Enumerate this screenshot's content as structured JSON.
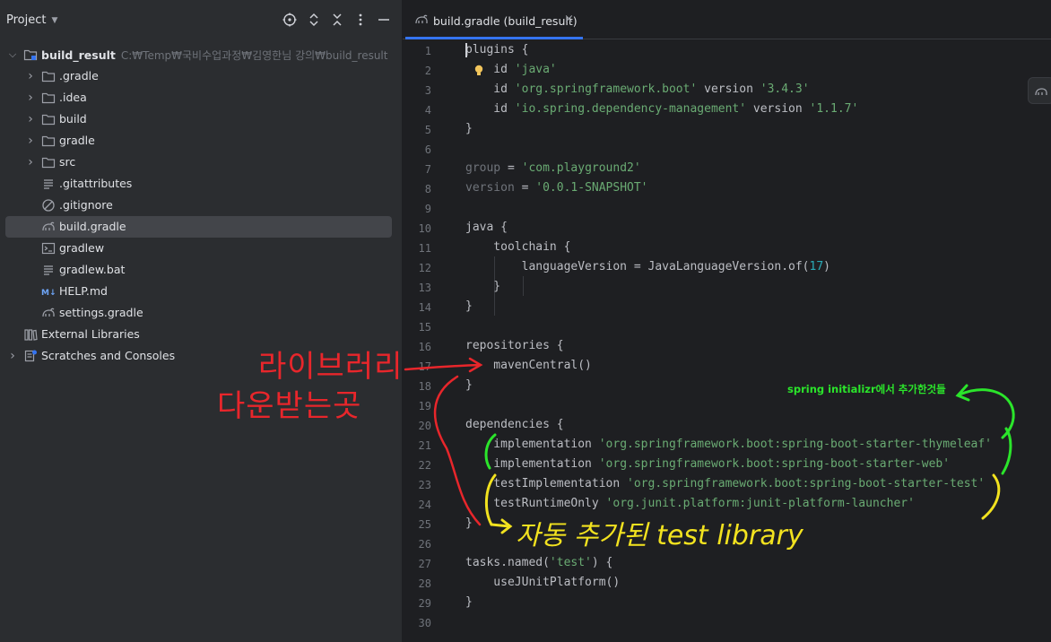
{
  "project_panel": {
    "title": "Project",
    "tree": [
      {
        "label": "build_result",
        "path": "C:₩Temp₩국비수업과정₩김영한님 강의₩build_result",
        "icon": "module-folder-icon",
        "expand": "expanded",
        "depth": 0
      },
      {
        "label": ".gradle",
        "icon": "folder-icon",
        "expand": "collapsed",
        "depth": 1
      },
      {
        "label": ".idea",
        "icon": "folder-icon",
        "expand": "collapsed",
        "depth": 1
      },
      {
        "label": "build",
        "icon": "folder-icon",
        "expand": "collapsed",
        "depth": 1
      },
      {
        "label": "gradle",
        "icon": "folder-icon",
        "expand": "collapsed",
        "depth": 1
      },
      {
        "label": "src",
        "icon": "folder-icon",
        "expand": "collapsed",
        "depth": 1
      },
      {
        "label": ".gitattributes",
        "icon": "text-file-icon",
        "expand": "none",
        "depth": 1
      },
      {
        "label": ".gitignore",
        "icon": "ignore-file-icon",
        "expand": "none",
        "depth": 1
      },
      {
        "label": "build.gradle",
        "icon": "gradle-elephant-icon",
        "expand": "none",
        "depth": 1,
        "selected": true
      },
      {
        "label": "gradlew",
        "icon": "terminal-file-icon",
        "expand": "none",
        "depth": 1
      },
      {
        "label": "gradlew.bat",
        "icon": "text-file-icon",
        "expand": "none",
        "depth": 1
      },
      {
        "label": "HELP.md",
        "icon": "markdown-file-icon",
        "expand": "none",
        "depth": 1
      },
      {
        "label": "settings.gradle",
        "icon": "gradle-elephant-icon",
        "expand": "none",
        "depth": 1
      },
      {
        "label": "External Libraries",
        "icon": "library-icon",
        "expand": "none",
        "depth": 0
      },
      {
        "label": "Scratches and Consoles",
        "icon": "scratches-icon",
        "expand": "collapsed",
        "depth": 0
      }
    ]
  },
  "editor": {
    "tab_label": "build.gradle (build_result)",
    "tab_close": "×",
    "line_numbers": [
      "1",
      "2",
      "3",
      "4",
      "5",
      "6",
      "7",
      "8",
      "9",
      "10",
      "11",
      "12",
      "13",
      "14",
      "15",
      "16",
      "17",
      "18",
      "19",
      "20",
      "21",
      "22",
      "23",
      "24",
      "25",
      "26",
      "27",
      "28",
      "29",
      "30"
    ],
    "code": [
      [
        {
          "t": "plugins {"
        }
      ],
      [
        {
          "t": "    id "
        },
        {
          "t": "'java'",
          "c": "str"
        }
      ],
      [
        {
          "t": "    id "
        },
        {
          "t": "'org.springframework.boot'",
          "c": "str"
        },
        {
          "t": " version "
        },
        {
          "t": "'3.4.3'",
          "c": "str"
        }
      ],
      [
        {
          "t": "    id "
        },
        {
          "t": "'io.spring.dependency-management'",
          "c": "str"
        },
        {
          "t": " version "
        },
        {
          "t": "'1.1.7'",
          "c": "str"
        }
      ],
      [
        {
          "t": "}"
        }
      ],
      [],
      [
        {
          "t": "group",
          "c": "dim"
        },
        {
          "t": " = "
        },
        {
          "t": "'com.playground2'",
          "c": "str"
        }
      ],
      [
        {
          "t": "version",
          "c": "dim"
        },
        {
          "t": " = "
        },
        {
          "t": "'0.0.1-SNAPSHOT'",
          "c": "str"
        }
      ],
      [],
      [
        {
          "t": "java {"
        }
      ],
      [
        {
          "t": "    toolchain {"
        }
      ],
      [
        {
          "t": "        languageVersion = JavaLanguageVersion.of("
        },
        {
          "t": "17",
          "c": "num"
        },
        {
          "t": ")"
        }
      ],
      [
        {
          "t": "    }"
        }
      ],
      [
        {
          "t": "}"
        }
      ],
      [],
      [
        {
          "t": "repositories {"
        }
      ],
      [
        {
          "t": "    mavenCentral()"
        }
      ],
      [
        {
          "t": "}"
        }
      ],
      [],
      [
        {
          "t": "dependencies {"
        }
      ],
      [
        {
          "t": "    implementation "
        },
        {
          "t": "'org.springframework.boot:spring-boot-starter-thymeleaf'",
          "c": "str"
        }
      ],
      [
        {
          "t": "    implementation "
        },
        {
          "t": "'org.springframework.boot:spring-boot-starter-web'",
          "c": "str"
        }
      ],
      [
        {
          "t": "    testImplementation "
        },
        {
          "t": "'org.springframework.boot:spring-boot-starter-test'",
          "c": "str"
        }
      ],
      [
        {
          "t": "    testRuntimeOnly "
        },
        {
          "t": "'org.junit.platform:junit-platform-launcher'",
          "c": "str"
        }
      ],
      [
        {
          "t": "}"
        }
      ],
      [],
      [
        {
          "t": "tasks.named("
        },
        {
          "t": "'test'",
          "c": "str"
        },
        {
          "t": ") {"
        }
      ],
      [
        {
          "t": "    useJUnitPlatform()"
        }
      ],
      [
        {
          "t": "}"
        }
      ],
      []
    ]
  },
  "annotations": {
    "red_line1": "라이브러리",
    "red_line2": "다운받는곳",
    "green_note": "spring initializr에서 추가한것들",
    "yellow_note": "자동 추가된 test library"
  },
  "colors": {
    "accent": "#3574f0",
    "string": "#6aab73",
    "number": "#2aacb8",
    "red_pen": "#e8262b",
    "green_pen": "#2be52b",
    "yellow_pen": "#f2e21f"
  }
}
